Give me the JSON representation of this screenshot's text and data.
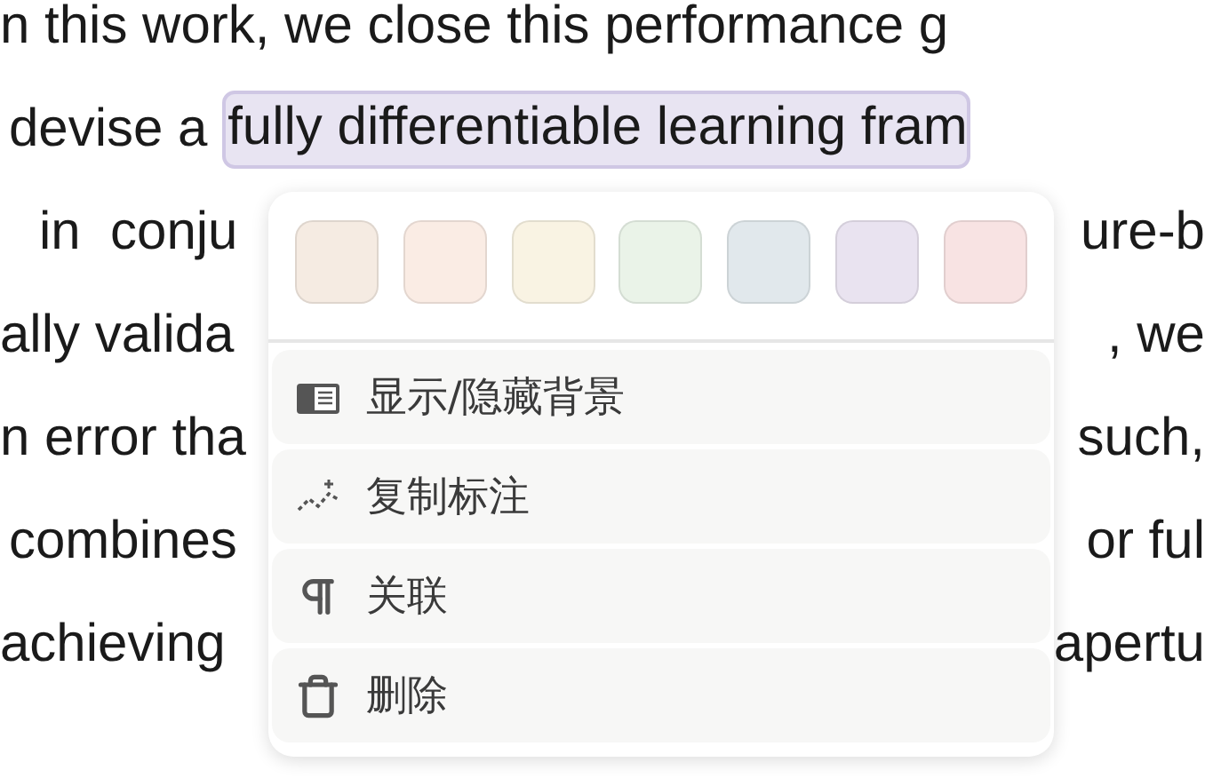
{
  "document": {
    "lines": [
      {
        "left": "n this work, we close this performance g"
      },
      {
        "left": "devise a ",
        "highlight": "fully differentiable learning fram"
      },
      {
        "left": "in  conju",
        "right": "ure-b"
      },
      {
        "left": "ally valida",
        "right": ", we"
      },
      {
        "left": "n error tha",
        "right": "such,"
      },
      {
        "left": "combines",
        "right": "or ful"
      },
      {
        "left": "achieving",
        "right": "apertu"
      }
    ]
  },
  "context_menu": {
    "swatches": [
      {
        "color": "#f5ebe2"
      },
      {
        "color": "#faece4"
      },
      {
        "color": "#f9f3e3"
      },
      {
        "color": "#eaf3e8"
      },
      {
        "color": "#e1e8ec"
      },
      {
        "color": "#e9e3f0"
      },
      {
        "color": "#f8e3e3"
      }
    ],
    "items": [
      {
        "kind": "background",
        "label": "显示/隐藏背景"
      },
      {
        "kind": "copy",
        "label": "复制标注"
      },
      {
        "kind": "link",
        "label": "关联"
      },
      {
        "kind": "delete",
        "label": "删除"
      }
    ]
  }
}
